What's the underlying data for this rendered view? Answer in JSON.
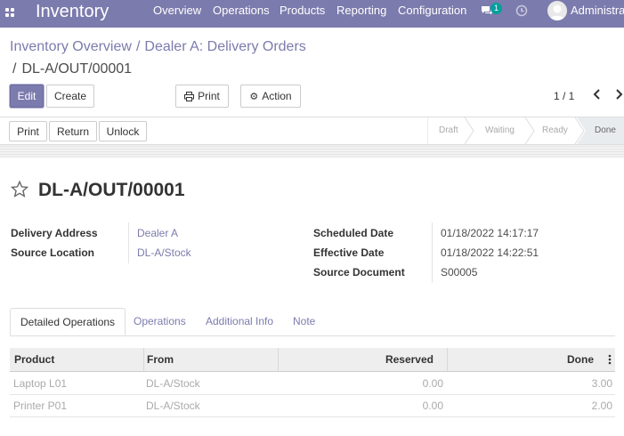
{
  "navbar": {
    "brand": "Inventory",
    "menu": [
      "Overview",
      "Operations",
      "Products",
      "Reporting",
      "Configuration"
    ],
    "messages_badge": "1",
    "user_name": "Administrator"
  },
  "breadcrumb": {
    "parent1": "Inventory Overview",
    "parent2": "Dealer A: Delivery Orders",
    "current": "DL-A/OUT/00001"
  },
  "toolbar": {
    "edit_label": "Edit",
    "create_label": "Create",
    "print_label": "Print",
    "action_label": "Action",
    "pager": "1 / 1"
  },
  "statusbar": {
    "buttons": [
      "Print",
      "Return",
      "Unlock"
    ],
    "stages": [
      "Draft",
      "Waiting",
      "Ready",
      "Done"
    ],
    "current_stage": "Done"
  },
  "record": {
    "name": "DL-A/OUT/00001",
    "fields_left": [
      {
        "label": "Delivery Address",
        "value": "Dealer A"
      },
      {
        "label": "Source Location",
        "value": "DL-A/Stock"
      }
    ],
    "fields_right": [
      {
        "label": "Scheduled Date",
        "value": "01/18/2022 14:17:17"
      },
      {
        "label": "Effective Date",
        "value": "01/18/2022 14:22:51"
      },
      {
        "label": "Source Document",
        "value": "S00005"
      }
    ]
  },
  "tabs": [
    "Detailed Operations",
    "Operations",
    "Additional Info",
    "Note"
  ],
  "table": {
    "columns": [
      "Product",
      "From",
      "Reserved",
      "Done"
    ],
    "rows": [
      {
        "product": "Laptop L01",
        "from": "DL-A/Stock",
        "reserved": "0.00",
        "done": "3.00"
      },
      {
        "product": "Printer P01",
        "from": "DL-A/Stock",
        "reserved": "0.00",
        "done": "2.00"
      }
    ]
  },
  "colors": {
    "brand": "#7c7bad",
    "badge": "#00a09d"
  }
}
